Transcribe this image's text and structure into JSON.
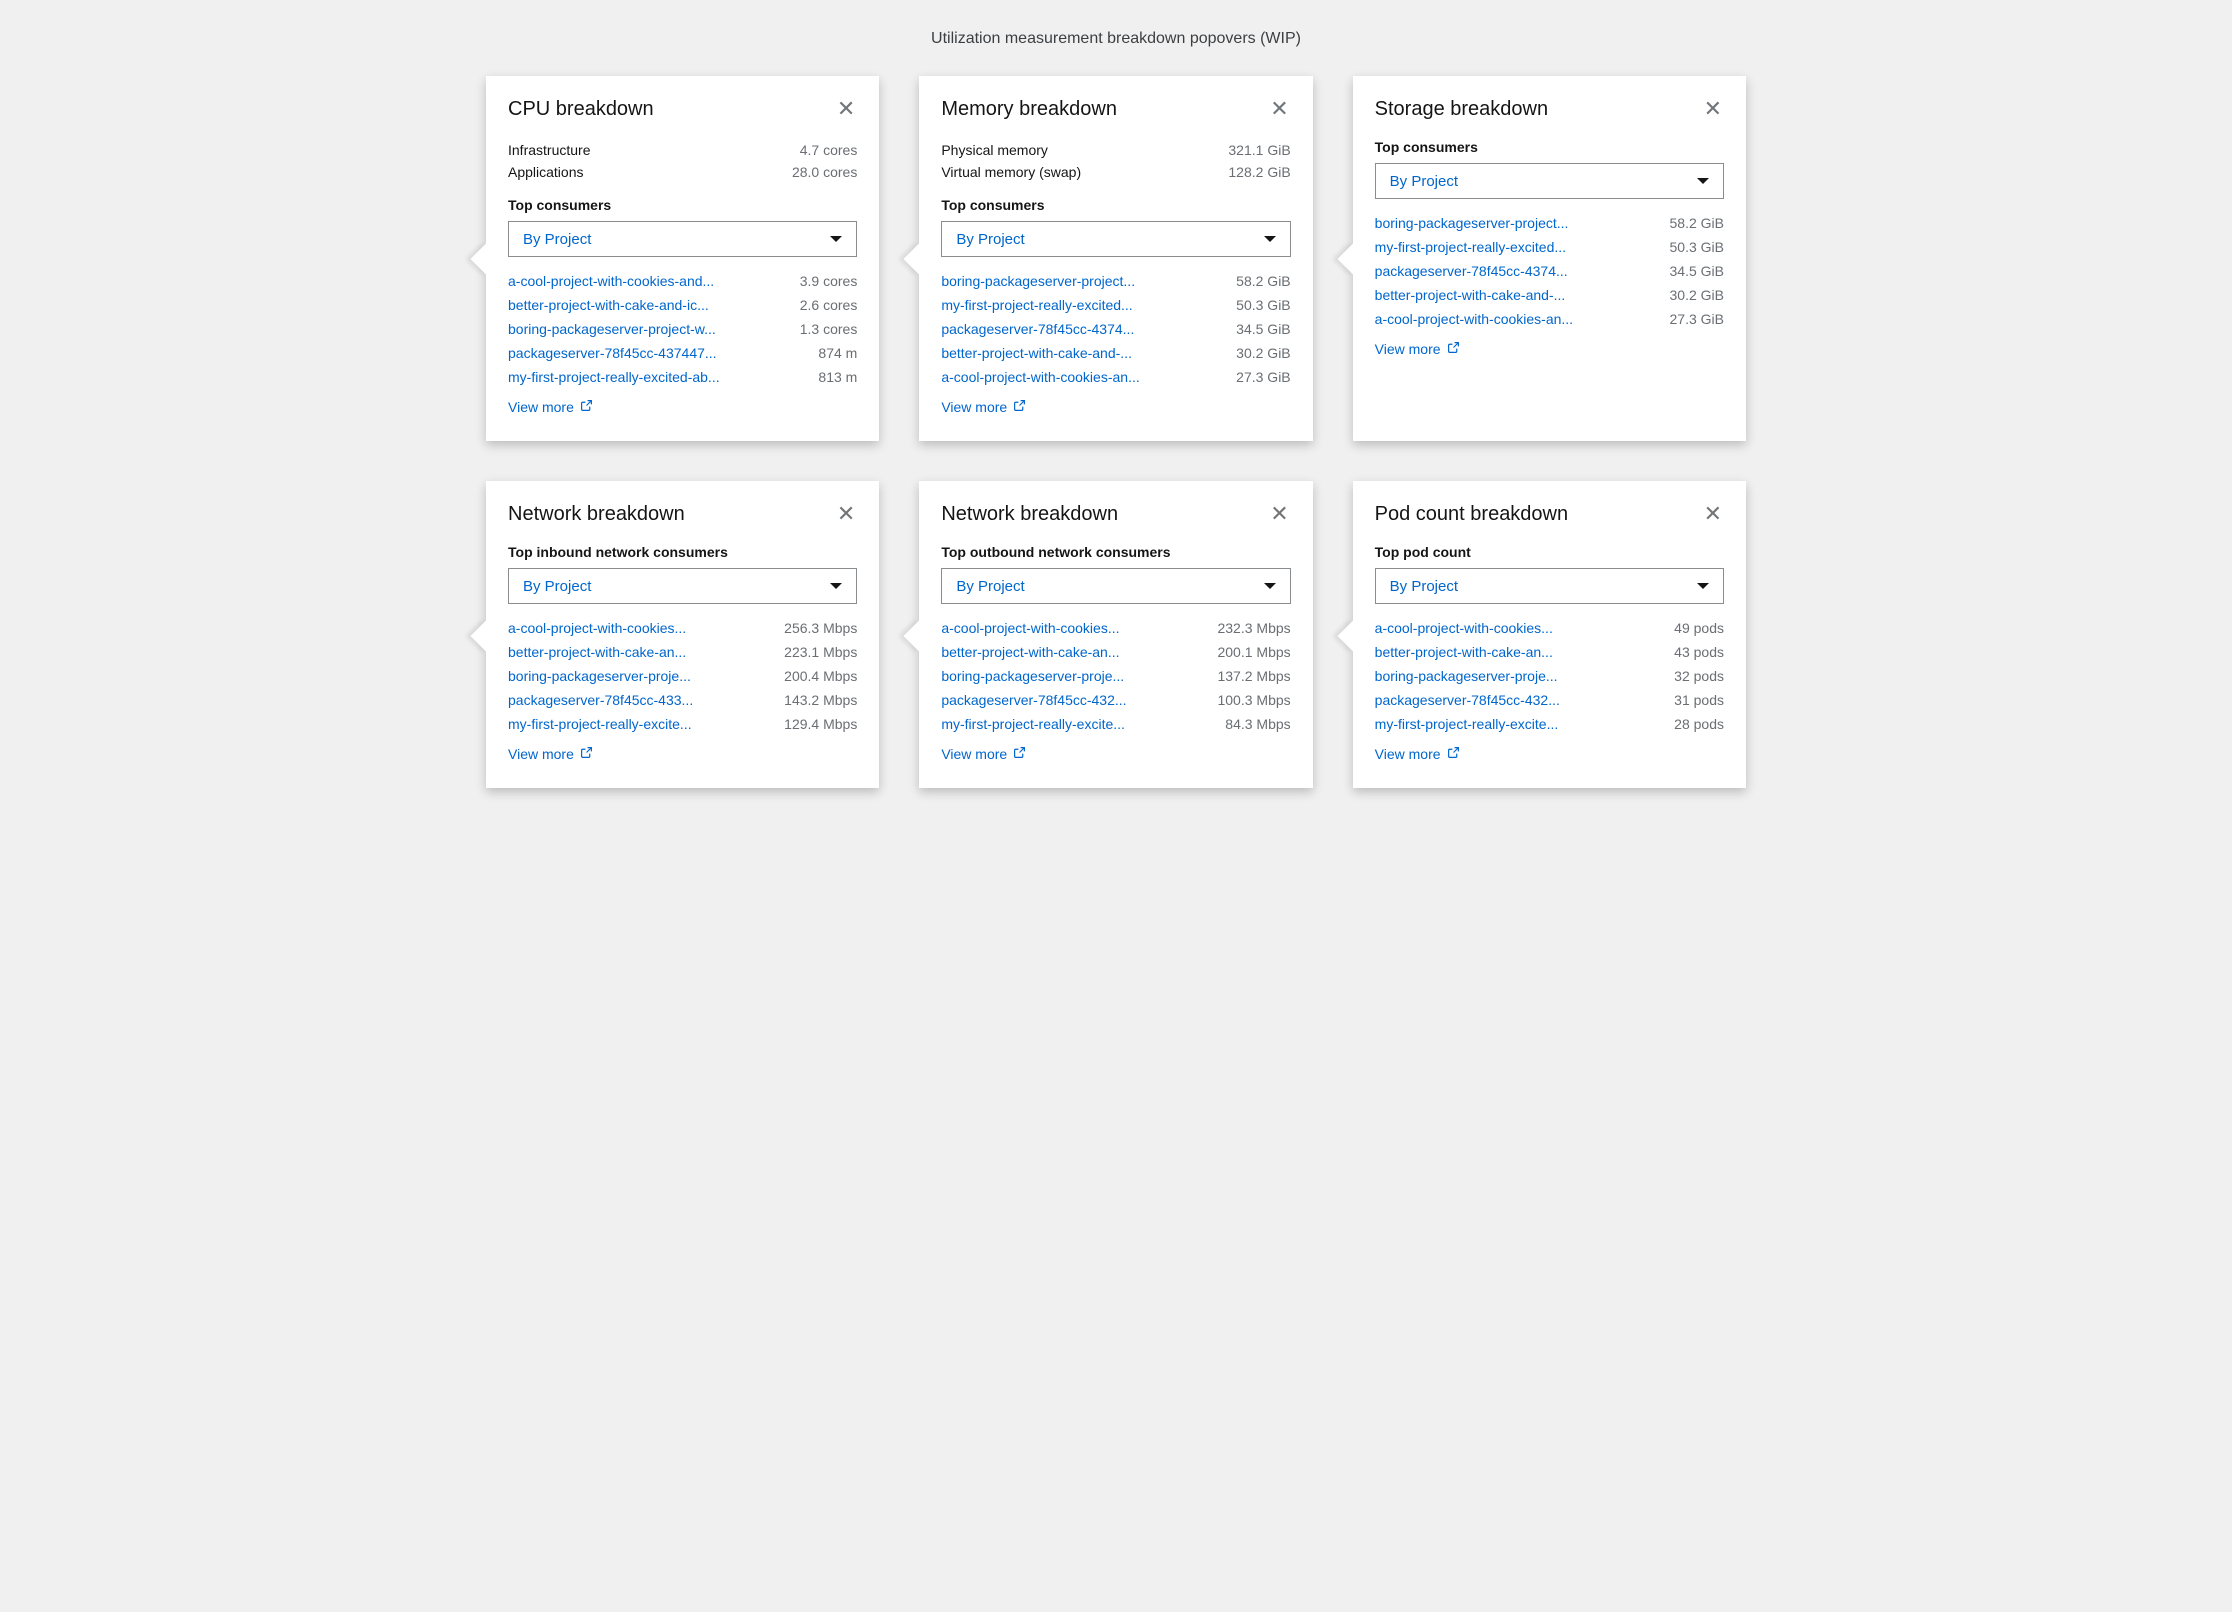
{
  "page_title": "Utilization measurement breakdown popovers (WIP)",
  "select_label": "By Project",
  "view_more_label": "View more",
  "cards": [
    {
      "id": "cpu",
      "title": "CPU breakdown",
      "summary": [
        {
          "label": "Infrastructure",
          "value": "4.7 cores"
        },
        {
          "label": "Applications",
          "value": "28.0 cores"
        }
      ],
      "section_label": "Top consumers",
      "consumers": [
        {
          "name": "a-cool-project-with-cookies-and...",
          "value": "3.9 cores"
        },
        {
          "name": "better-project-with-cake-and-ic...",
          "value": "2.6 cores"
        },
        {
          "name": "boring-packageserver-project-w...",
          "value": "1.3 cores"
        },
        {
          "name": "packageserver-78f45cc-437447...",
          "value": "874 m"
        },
        {
          "name": "my-first-project-really-excited-ab...",
          "value": "813 m"
        }
      ]
    },
    {
      "id": "memory",
      "title": "Memory breakdown",
      "summary": [
        {
          "label": "Physical memory",
          "value": "321.1 GiB"
        },
        {
          "label": "Virtual memory (swap)",
          "value": "128.2 GiB"
        }
      ],
      "section_label": "Top consumers",
      "consumers": [
        {
          "name": "boring-packageserver-project...",
          "value": "58.2 GiB"
        },
        {
          "name": "my-first-project-really-excited...",
          "value": "50.3 GiB"
        },
        {
          "name": "packageserver-78f45cc-4374...",
          "value": "34.5 GiB"
        },
        {
          "name": "better-project-with-cake-and-...",
          "value": "30.2 GiB"
        },
        {
          "name": "a-cool-project-with-cookies-an...",
          "value": "27.3 GiB"
        }
      ]
    },
    {
      "id": "storage",
      "title": "Storage breakdown",
      "summary": [],
      "section_label": "Top consumers",
      "consumers": [
        {
          "name": "boring-packageserver-project...",
          "value": "58.2 GiB"
        },
        {
          "name": "my-first-project-really-excited...",
          "value": "50.3 GiB"
        },
        {
          "name": "packageserver-78f45cc-4374...",
          "value": "34.5 GiB"
        },
        {
          "name": "better-project-with-cake-and-...",
          "value": "30.2 GiB"
        },
        {
          "name": "a-cool-project-with-cookies-an...",
          "value": "27.3 GiB"
        }
      ]
    },
    {
      "id": "net-in",
      "title": "Network breakdown",
      "summary": [],
      "section_label": "Top inbound network consumers",
      "consumers": [
        {
          "name": "a-cool-project-with-cookies...",
          "value": "256.3 Mbps"
        },
        {
          "name": "better-project-with-cake-an...",
          "value": "223.1 Mbps"
        },
        {
          "name": "boring-packageserver-proje...",
          "value": "200.4 Mbps"
        },
        {
          "name": "packageserver-78f45cc-433...",
          "value": "143.2 Mbps"
        },
        {
          "name": "my-first-project-really-excite...",
          "value": "129.4 Mbps"
        }
      ]
    },
    {
      "id": "net-out",
      "title": "Network breakdown",
      "summary": [],
      "section_label": "Top outbound network consumers",
      "consumers": [
        {
          "name": "a-cool-project-with-cookies...",
          "value": "232.3 Mbps"
        },
        {
          "name": "better-project-with-cake-an...",
          "value": "200.1 Mbps"
        },
        {
          "name": "boring-packageserver-proje...",
          "value": "137.2 Mbps"
        },
        {
          "name": "packageserver-78f45cc-432...",
          "value": "100.3 Mbps"
        },
        {
          "name": "my-first-project-really-excite...",
          "value": "84.3 Mbps"
        }
      ]
    },
    {
      "id": "pod",
      "title": "Pod count breakdown",
      "summary": [],
      "section_label": "Top pod count",
      "consumers": [
        {
          "name": "a-cool-project-with-cookies...",
          "value": "49 pods"
        },
        {
          "name": "better-project-with-cake-an...",
          "value": "43 pods"
        },
        {
          "name": "boring-packageserver-proje...",
          "value": "32 pods"
        },
        {
          "name": "packageserver-78f45cc-432...",
          "value": "31 pods"
        },
        {
          "name": "my-first-project-really-excite...",
          "value": "28 pods"
        }
      ]
    }
  ]
}
